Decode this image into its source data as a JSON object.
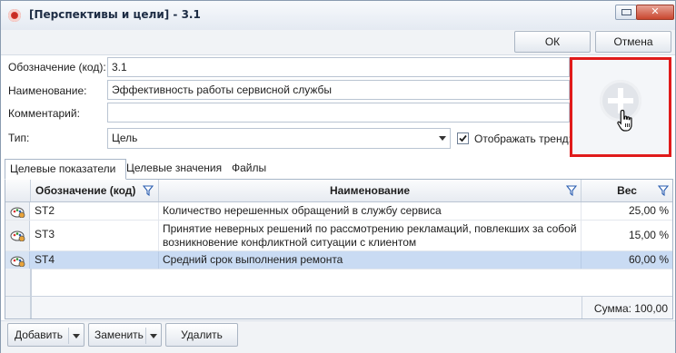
{
  "window": {
    "title": "[Перспективы и цели] - 3.1",
    "close_glyph": "✕"
  },
  "toolbar": {
    "ok_label": "ОК",
    "cancel_label": "Отмена"
  },
  "form": {
    "code_label": "Обозначение (код):",
    "code_value": "3.1",
    "name_label": "Наименование:",
    "name_value": "Эффективность работы сервисной службы",
    "comment_label": "Комментарий:",
    "comment_value": "",
    "type_label": "Тип:",
    "type_value": "Цель",
    "show_trend_label": "Отображать тренд:",
    "show_trend_checked": true
  },
  "tabs": [
    {
      "label": "Целевые показатели",
      "active": true
    },
    {
      "label": "Целевые значения",
      "active": false
    },
    {
      "label": "Файлы",
      "active": false
    }
  ],
  "grid": {
    "columns": [
      "Обозначение (код)",
      "Наименование",
      "Вес"
    ],
    "rows": [
      {
        "code": "ST2",
        "name": "Количество нерешенных обращений в службу сервиса",
        "weight": "25,00 %",
        "selected": false
      },
      {
        "code": "ST3",
        "name": "Принятие неверных решений по рассмотрению рекламаций, повлекших за собой возникновение конфликтной ситуации с клиентом",
        "weight": "15,00 %",
        "selected": false
      },
      {
        "code": "ST4",
        "name": "Средний срок выполнения ремонта",
        "weight": "60,00 %",
        "selected": true
      }
    ],
    "sum_label": "Сумма: 100,00 %"
  },
  "bottom": {
    "add_label": "Добавить",
    "replace_label": "Заменить",
    "delete_label": "Удалить"
  },
  "icons": {
    "app": "target-icon",
    "picture": "add-image-icon",
    "cursor": "hand-cursor-icon",
    "filter": "filter-icon",
    "row": "indicator-icon"
  },
  "colors": {
    "highlight_border": "#e01b1b",
    "selected_row": "#c9dbf3",
    "close_button": "#c9472f"
  }
}
